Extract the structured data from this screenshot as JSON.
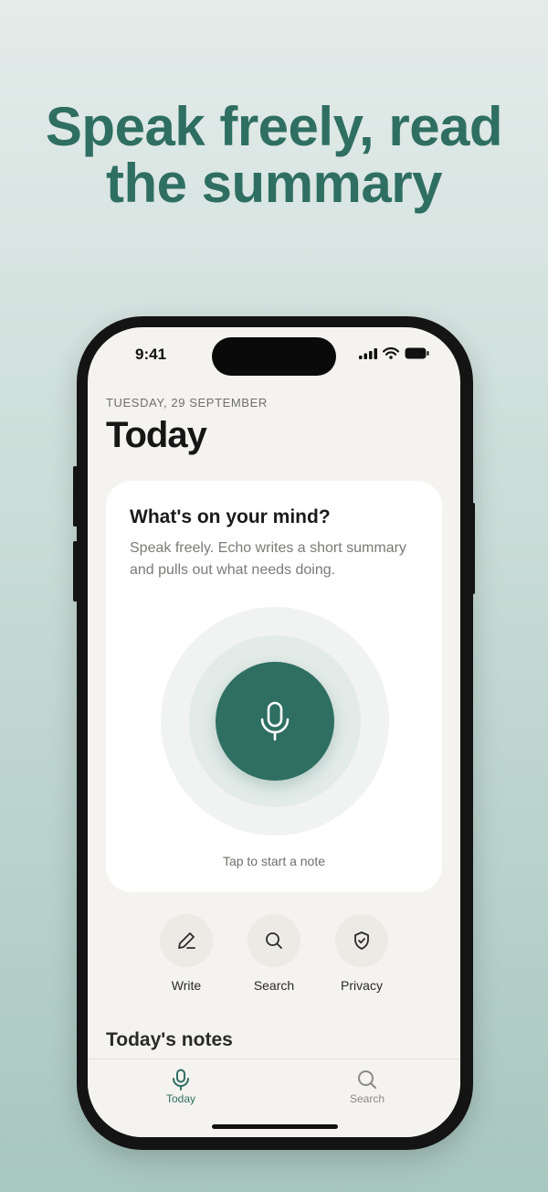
{
  "headline": {
    "line1": "Speak freely, read",
    "line2": "the summary"
  },
  "status_bar": {
    "time": "9:41"
  },
  "header": {
    "date": "TUESDAY, 29 SEPTEMBER",
    "title": "Today"
  },
  "record_card": {
    "title": "What's on your mind?",
    "description": "Speak freely. Echo writes a short summary and pulls out what needs doing.",
    "hint": "Tap to start a note"
  },
  "actions": [
    {
      "label": "Write",
      "icon": "pencil-icon"
    },
    {
      "label": "Search",
      "icon": "search-icon"
    },
    {
      "label": "Privacy",
      "icon": "shield-check-icon"
    }
  ],
  "notes_section": {
    "heading": "Today's notes"
  },
  "tab_bar": [
    {
      "label": "Today",
      "icon": "microphone-icon",
      "active": true
    },
    {
      "label": "Search",
      "icon": "search-icon",
      "active": false
    }
  ],
  "colors": {
    "accent": "#2f6f62",
    "background": "#f4f3ef",
    "tab_inactive": "#8a8a86"
  }
}
